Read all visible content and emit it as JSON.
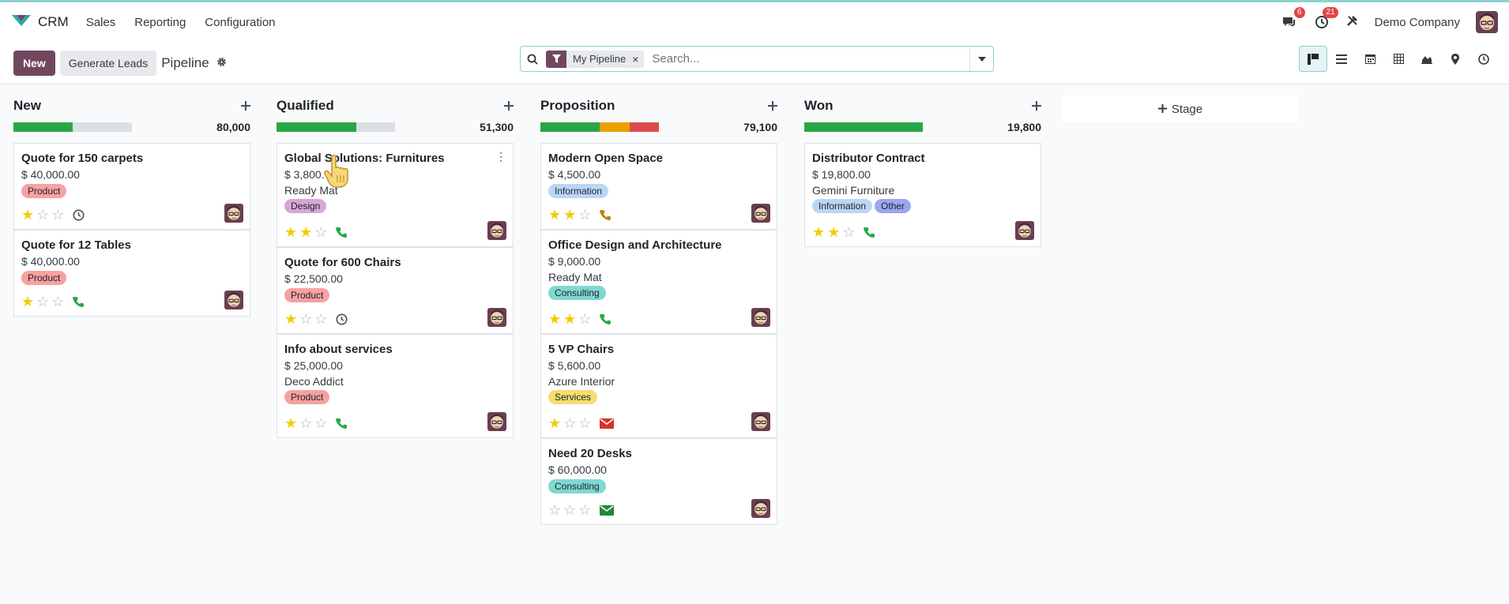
{
  "app": {
    "name": "CRM"
  },
  "nav": {
    "items": [
      "Sales",
      "Reporting",
      "Configuration"
    ]
  },
  "systray": {
    "messages_count": "6",
    "activities_count": "21",
    "company": "Demo Company"
  },
  "control": {
    "new_label": "New",
    "generate_label": "Generate Leads",
    "breadcrumb": "Pipeline",
    "facet": "My Pipeline",
    "facet_remove": "×",
    "search_placeholder": "Search..."
  },
  "views": [
    "kanban-icon",
    "list-icon",
    "calendar-icon",
    "pivot-icon",
    "graph-icon",
    "map-icon",
    "activity-icon"
  ],
  "add_stage_label": "Stage",
  "columns": [
    {
      "title": "New",
      "total": "80,000",
      "progress": [
        {
          "color": "#28a745",
          "fraction": 0.5
        }
      ],
      "cards": [
        {
          "title": "Quote for 150 carpets",
          "amount": "$ 40,000.00",
          "company": "",
          "tags": [
            {
              "label": "Product",
              "color": "#f8a1a1"
            }
          ],
          "stars": 1,
          "activity": "clock-icon"
        },
        {
          "title": "Quote for 12 Tables",
          "amount": "$ 40,000.00",
          "company": "",
          "tags": [
            {
              "label": "Product",
              "color": "#f8a1a1"
            }
          ],
          "stars": 1,
          "activity": "phone-icon"
        }
      ]
    },
    {
      "title": "Qualified",
      "total": "51,300",
      "progress": [
        {
          "color": "#28a745",
          "fraction": 0.67
        }
      ],
      "cards": [
        {
          "title": "Global Solutions: Furnitures",
          "amount": "$ 3,800.",
          "company": "Ready Mat",
          "tags": [
            {
              "label": "Design",
              "color": "#d7a6d8"
            }
          ],
          "stars": 2,
          "activity": "phone-icon",
          "menu": "⋮"
        },
        {
          "title": "Quote for 600 Chairs",
          "amount": "$ 22,500.00",
          "company": "",
          "tags": [
            {
              "label": "Product",
              "color": "#f8a1a1"
            }
          ],
          "stars": 1,
          "activity": "clock-icon"
        },
        {
          "title": "Info about services",
          "amount": "$ 25,000.00",
          "company": "Deco Addict",
          "tags": [
            {
              "label": "Product",
              "color": "#f8a1a1"
            }
          ],
          "stars": 1,
          "activity": "phone-icon"
        }
      ]
    },
    {
      "title": "Proposition",
      "total": "79,100",
      "progress": [
        {
          "color": "#28a745",
          "fraction": 0.5
        },
        {
          "color": "#e8a000",
          "fraction": 0.25
        },
        {
          "color": "#dc4c4c",
          "fraction": 0.25
        }
      ],
      "cards": [
        {
          "title": "Modern Open Space",
          "amount": "$ 4,500.00",
          "company": "",
          "tags": [
            {
              "label": "Information",
              "color": "#b9d7f5"
            }
          ],
          "stars": 2,
          "activity": "phone-icon-orange"
        },
        {
          "title": "Office Design and Architecture",
          "amount": "$ 9,000.00",
          "company": "Ready Mat",
          "tags": [
            {
              "label": "Consulting",
              "color": "#7fd8d2"
            }
          ],
          "stars": 2,
          "activity": "phone-icon"
        },
        {
          "title": "5 VP Chairs",
          "amount": "$ 5,600.00",
          "company": "Azure Interior",
          "tags": [
            {
              "label": "Services",
              "color": "#f7dd6f"
            }
          ],
          "stars": 1,
          "activity": "envelope-icon-red"
        },
        {
          "title": "Need 20 Desks",
          "amount": "$ 60,000.00",
          "company": "",
          "tags": [
            {
              "label": "Consulting",
              "color": "#7fd8d2"
            }
          ],
          "stars": 0,
          "activity": "envelope-icon-green"
        }
      ]
    },
    {
      "title": "Won",
      "total": "19,800",
      "progress": [
        {
          "color": "#28a745",
          "fraction": 1.0
        }
      ],
      "cards": [
        {
          "title": "Distributor Contract",
          "amount": "$ 19,800.00",
          "company": "Gemini Furniture",
          "tags": [
            {
              "label": "Information",
              "color": "#b9d7f5"
            },
            {
              "label": "Other",
              "color": "#9aa7f0"
            }
          ],
          "stars": 2,
          "activity": "phone-icon"
        }
      ]
    }
  ]
}
